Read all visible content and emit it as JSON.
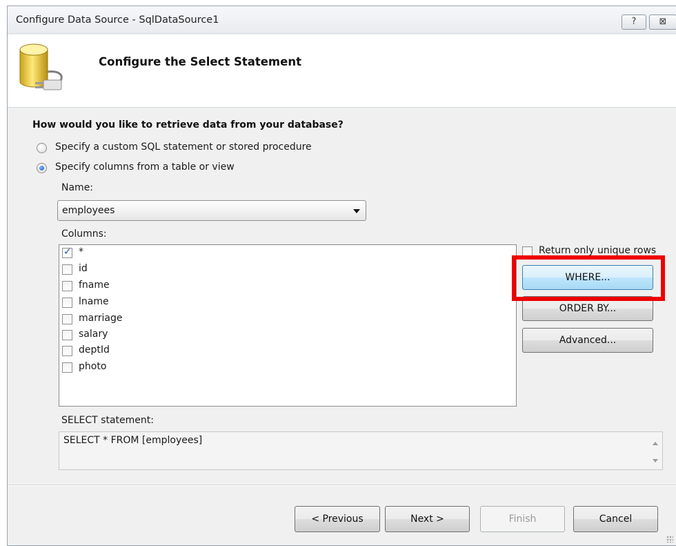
{
  "window": {
    "title": "Configure Data Source - SqlDataSource1",
    "help_label": "?",
    "close_label": "⊠"
  },
  "header": {
    "title": "Configure the Select Statement",
    "icon": "database-connector-icon"
  },
  "question": "How would you like to retrieve data from your database?",
  "options": {
    "custom_sql": "Specify a custom SQL statement or stored procedure",
    "columns_from_table": "Specify columns from a table or view",
    "selected": "columns_from_table"
  },
  "name_field": {
    "label": "Name:",
    "value": "employees"
  },
  "columns": {
    "label": "Columns:",
    "items": [
      {
        "label": "*",
        "checked": true
      },
      {
        "label": "id",
        "checked": false
      },
      {
        "label": "fname",
        "checked": false
      },
      {
        "label": "lname",
        "checked": false
      },
      {
        "label": "marriage",
        "checked": false
      },
      {
        "label": "salary",
        "checked": false
      },
      {
        "label": "deptId",
        "checked": false
      },
      {
        "label": "photo",
        "checked": false
      }
    ]
  },
  "side_panel": {
    "unique_rows_label": "Return only unique rows",
    "unique_rows_checked": false,
    "where_label": "WHERE...",
    "order_by_label": "ORDER BY...",
    "advanced_label": "Advanced..."
  },
  "select_statement": {
    "label": "SELECT statement:",
    "value": "SELECT * FROM [employees]"
  },
  "footer": {
    "previous_label": "< Previous",
    "next_label": "Next >",
    "finish_label": "Finish",
    "cancel_label": "Cancel"
  },
  "colors": {
    "highlight": "#ee0000",
    "dialog_bg": "#f0f0f0",
    "focus_blue": "#3c7fb1"
  }
}
